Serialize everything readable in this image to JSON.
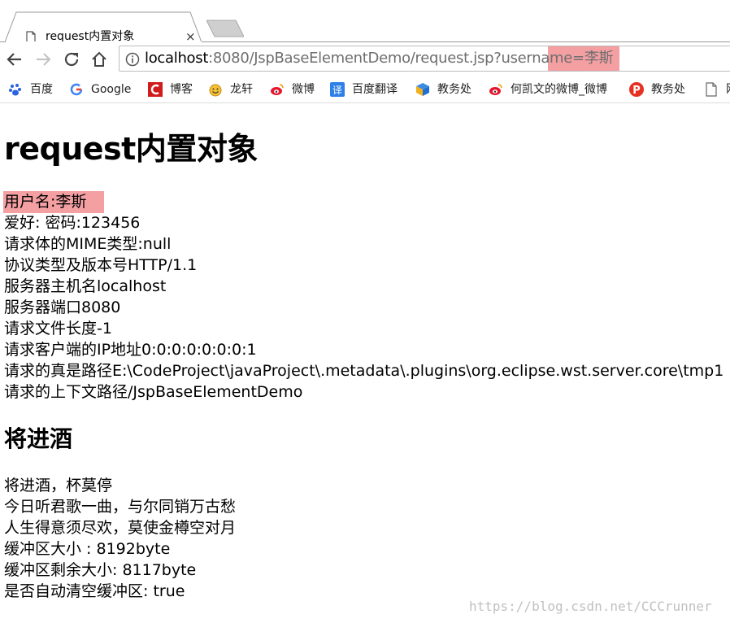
{
  "tab": {
    "title": "request内置对象",
    "close": "×"
  },
  "toolbar": {
    "url_host": "localhost",
    "url_rest": ":8080/JspBaseElementDemo/request.jsp?username=李斯"
  },
  "bookmarks": [
    {
      "label": "百度",
      "icon": "baidu-paw-icon",
      "color": "#2a62e0"
    },
    {
      "label": "Google",
      "icon": "google-g-icon",
      "color": "#4285f4"
    },
    {
      "label": "博客",
      "icon": "csdn-c-icon",
      "color": "#d01c1c"
    },
    {
      "label": "龙轩",
      "icon": "smiley-icon",
      "color": "#f2b01e"
    },
    {
      "label": "微博",
      "icon": "weibo-icon",
      "color": "#e6162d"
    },
    {
      "label": "百度翻译",
      "icon": "translate-icon",
      "color": "#2e7fe8"
    },
    {
      "label": "教务处",
      "icon": "cube-icon",
      "color": "#1f6fd1"
    },
    {
      "label": "何凯文的微博_微博",
      "icon": "weibo-icon",
      "color": "#e6162d"
    },
    {
      "label": "教务处",
      "icon": "p-badge-icon",
      "color": "#e63022"
    },
    {
      "label": "网",
      "icon": "page-icon",
      "color": "#666666"
    }
  ],
  "page": {
    "title": "request内置对象",
    "lines": [
      "用户名:李斯",
      "爱好: 密码:123456",
      "请求体的MIME类型:null",
      "协议类型及版本号HTTP/1.1",
      "服务器主机名localhost",
      "服务器端口8080",
      "请求文件长度-1",
      "请求客户端的IP地址0:0:0:0:0:0:0:1",
      "请求的真是路径E:\\CodeProject\\javaProject\\.metadata\\.plugins\\org.eclipse.wst.server.core\\tmp1",
      "请求的上下文路径/JspBaseElementDemo"
    ],
    "poem_title": "将进酒",
    "poem_lines": [
      "将进酒，杯莫停",
      "今日听君歌一曲，与尔同销万古愁",
      "人生得意须尽欢，莫使金樽空对月",
      "缓冲区大小 : 8192byte",
      "缓冲区剩余大小: 8117byte",
      "是否自动清空缓冲区: true"
    ]
  },
  "watermark": "https://blog.csdn.net/CCCrunner"
}
